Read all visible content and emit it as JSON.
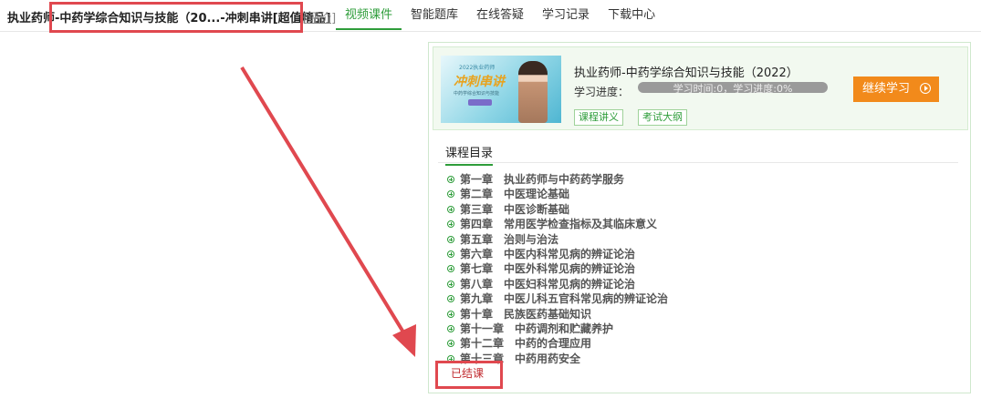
{
  "header": {
    "course_title": "执业药师-中药学综合知识与技能（20...-冲刺串讲[超值精品]",
    "rate_link": "[评价]",
    "tabs": [
      {
        "label": "视频课件",
        "active": true
      },
      {
        "label": "智能题库",
        "active": false
      },
      {
        "label": "在线答疑",
        "active": false
      },
      {
        "label": "学习记录",
        "active": false
      },
      {
        "label": "下载中心",
        "active": false
      }
    ]
  },
  "course_card": {
    "thumbnail": {
      "line1": "2022执业药师",
      "line2": "冲刺串讲",
      "line3": "中药学综合知识与技能"
    },
    "title": "执业药师-中药学综合知识与技能（2022）",
    "progress_label": "学习进度：",
    "progress_text": "学习时间:0，学习进度:0%",
    "progress_value": 0,
    "lecture_notes_button": "课程讲义",
    "exam_outline_button": "考试大纲",
    "continue_button": "继续学习"
  },
  "toc": {
    "header": "课程目录",
    "chapters": [
      {
        "num": "第一章",
        "title": "执业药师与中药药学服务"
      },
      {
        "num": "第二章",
        "title": "中医理论基础"
      },
      {
        "num": "第三章",
        "title": "中医诊断基础"
      },
      {
        "num": "第四章",
        "title": "常用医学检查指标及其临床意义"
      },
      {
        "num": "第五章",
        "title": "治则与治法"
      },
      {
        "num": "第六章",
        "title": "中医内科常见病的辨证论治"
      },
      {
        "num": "第七章",
        "title": "中医外科常见病的辨证论治"
      },
      {
        "num": "第八章",
        "title": "中医妇科常见病的辨证论治"
      },
      {
        "num": "第九章",
        "title": "中医儿科五官科常见病的辨证论治"
      },
      {
        "num": "第十章",
        "title": "民族医药基础知识"
      },
      {
        "num": "第十一章",
        "title": "中药调剂和贮藏养护"
      },
      {
        "num": "第十二章",
        "title": "中药的合理应用"
      },
      {
        "num": "第十三章",
        "title": "中药用药安全"
      }
    ],
    "status": "已结课"
  },
  "colors": {
    "accent_green": "#2e9d3a",
    "continue_orange": "#f28a1b",
    "annotation_red": "#e0484f",
    "status_red": "#c0282d"
  }
}
